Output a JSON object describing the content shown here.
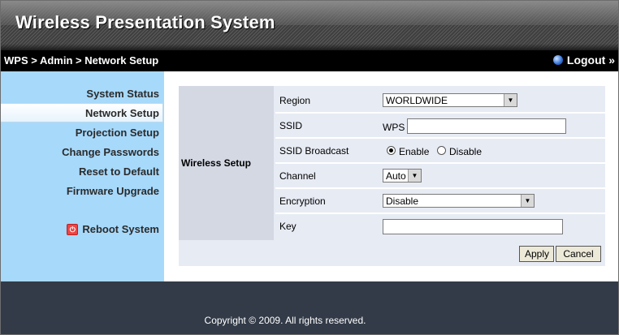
{
  "app": {
    "title": "Wireless Presentation System"
  },
  "topbar": {
    "breadcrumb": "WPS > Admin > Network Setup",
    "logout_label": "Logout »"
  },
  "sidebar": {
    "items": [
      {
        "label": "System Status"
      },
      {
        "label": "Network Setup",
        "active": true
      },
      {
        "label": "Projection Setup"
      },
      {
        "label": "Change Passwords"
      },
      {
        "label": "Reset to Default"
      },
      {
        "label": "Firmware Upgrade"
      }
    ],
    "reboot_label": "Reboot System"
  },
  "form": {
    "section_label": "Wireless Setup",
    "region": {
      "label": "Region",
      "value": "WORLDWIDE"
    },
    "ssid": {
      "label": "SSID",
      "prefix": "WPS",
      "value": ""
    },
    "ssid_broadcast": {
      "label": "SSID Broadcast",
      "enable_label": "Enable",
      "disable_label": "Disable",
      "selected": "Enable"
    },
    "channel": {
      "label": "Channel",
      "value": "Auto"
    },
    "encryption": {
      "label": "Encryption",
      "value": "Disable"
    },
    "key": {
      "label": "Key",
      "value": ""
    },
    "apply_label": "Apply",
    "cancel_label": "Cancel"
  },
  "footer": {
    "copyright": "Copyright © 2009. All rights reserved."
  },
  "colors": {
    "sidebar_bg": "#a7d9fb",
    "footer_bg": "#333b48",
    "panel_bg": "#e7ebf4",
    "section_bg": "#d4d8e3"
  }
}
